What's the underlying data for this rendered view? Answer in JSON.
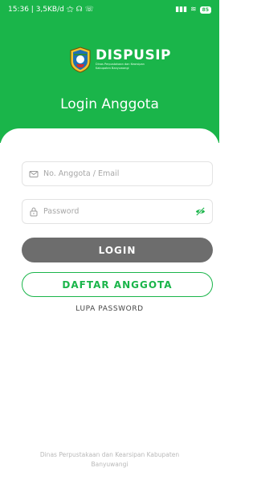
{
  "status_bar": {
    "time_info": "15:36 | 3,5KB/d",
    "battery": "85"
  },
  "brand": {
    "name": "DISPUSIP",
    "subtitle_line1": "Dinas Perpustakaan dan Kearsipan",
    "subtitle_line2": "Kabupaten Banyuwangi",
    "accent_color": "#1ab54a"
  },
  "page_title": "Login Anggota",
  "form": {
    "email_placeholder": "No. Anggota / Email",
    "email_value": "",
    "password_placeholder": "Password",
    "password_value": "",
    "login_label": "LOGIN",
    "register_label": "DAFTAR ANGGOTA",
    "forgot_label": "LUPA PASSWORD"
  },
  "footer": {
    "line1": "Dinas Perpustakaan dan Kearsipan Kabupaten",
    "line2": "Banyuwangi"
  },
  "icons": {
    "email": "mail-icon",
    "password": "lock-icon",
    "toggle": "eye-off-icon"
  }
}
